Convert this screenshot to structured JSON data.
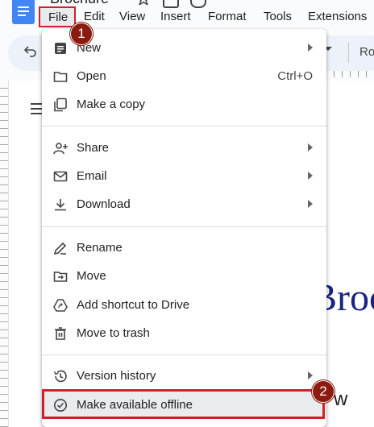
{
  "app": {
    "doc_title": "Brochure"
  },
  "menubar": {
    "items": [
      "File",
      "Edit",
      "View",
      "Insert",
      "Format",
      "Tools",
      "Extensions"
    ]
  },
  "toolbar": {
    "font_name": "Ro"
  },
  "document": {
    "heading": "Broc",
    "subtext": "w"
  },
  "file_menu": {
    "groups": [
      [
        {
          "label": "New",
          "icon": "document-icon",
          "submenu": true
        },
        {
          "label": "Open",
          "icon": "folder-icon",
          "shortcut": "Ctrl+O"
        },
        {
          "label": "Make a copy",
          "icon": "copy-icon"
        }
      ],
      [
        {
          "label": "Share",
          "icon": "person-add-icon",
          "submenu": true
        },
        {
          "label": "Email",
          "icon": "mail-icon",
          "submenu": true
        },
        {
          "label": "Download",
          "icon": "download-icon",
          "submenu": true
        }
      ],
      [
        {
          "label": "Rename",
          "icon": "pencil-icon"
        },
        {
          "label": "Move",
          "icon": "move-folder-icon"
        },
        {
          "label": "Add shortcut to Drive",
          "icon": "drive-shortcut-icon"
        },
        {
          "label": "Move to trash",
          "icon": "trash-icon"
        }
      ],
      [
        {
          "label": "Version history",
          "icon": "history-icon",
          "submenu": true
        },
        {
          "label": "Make available offline",
          "icon": "offline-check-icon",
          "highlighted": true
        }
      ]
    ]
  },
  "annotations": {
    "step1": "1",
    "step2": "2",
    "accent": "#d0212b",
    "badge_color": "#8b1a10"
  }
}
